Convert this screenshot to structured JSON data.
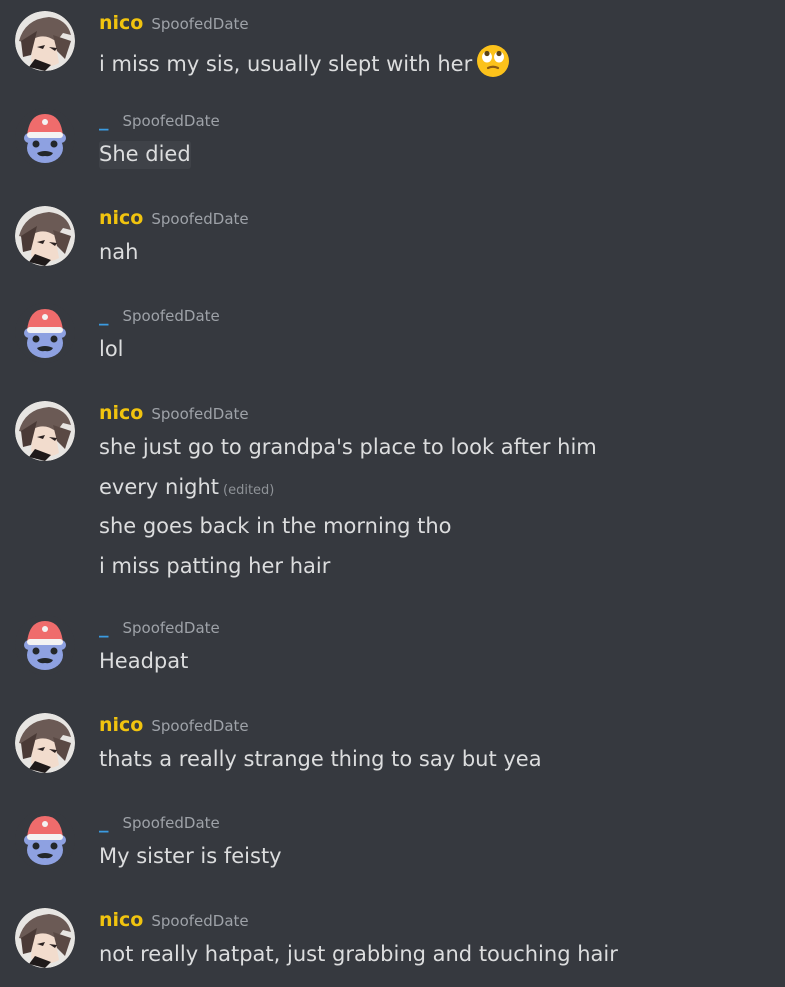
{
  "chat": {
    "m1": {
      "author": "nico",
      "stamp": "SpoofedDate",
      "lines": [
        "i miss my sis, usually slept with her"
      ],
      "emoji": "eye-roll-emoji"
    },
    "m2": {
      "author": "_",
      "stamp": "SpoofedDate",
      "lines": [
        "She died"
      ]
    },
    "m3": {
      "author": "nico",
      "stamp": "SpoofedDate",
      "lines": [
        "nah"
      ]
    },
    "m4": {
      "author": "_",
      "stamp": "SpoofedDate",
      "lines": [
        "lol"
      ]
    },
    "m5": {
      "author": "nico",
      "stamp": "SpoofedDate",
      "lines": [
        "she just go to grandpa's place to look after him",
        "every night",
        "she goes back in the morning tho",
        "i miss patting her hair"
      ],
      "edited": "(edited)"
    },
    "m6": {
      "author": "_",
      "stamp": "SpoofedDate",
      "lines": [
        "Headpat"
      ]
    },
    "m7": {
      "author": "nico",
      "stamp": "SpoofedDate",
      "lines": [
        "thats a really strange thing to say but yea"
      ]
    },
    "m8": {
      "author": "_",
      "stamp": "SpoofedDate",
      "lines": [
        "My sister is feisty"
      ]
    },
    "m9": {
      "author": "nico",
      "stamp": "SpoofedDate",
      "lines": [
        "not really hatpat, just grabbing and touching hair"
      ]
    }
  },
  "colors": {
    "background": "#36393f",
    "nico_name": "#f1c40f",
    "underscore_name": "#3b9be0",
    "message_text": "#dcddde",
    "timestamp": "#9ea2a8"
  }
}
